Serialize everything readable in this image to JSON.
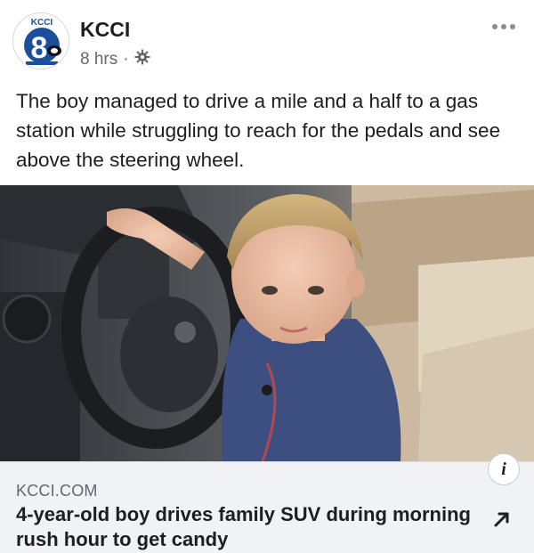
{
  "header": {
    "avatar_text": "8",
    "avatar_top_text": "KCCI",
    "page_name": "KCCI",
    "timestamp": "8 hrs",
    "separator": "·",
    "audience_icon": "gear-icon",
    "more_icon": "more-dots-icon"
  },
  "post": {
    "text": "The boy managed to drive a mile and a half to a gas station while struggling to reach for the pedals and see above the steering wheel."
  },
  "photo": {
    "subject": "boy-at-steering-wheel"
  },
  "link": {
    "domain": "KCCI.COM",
    "title": "4-year-old boy drives family SUV during morning rush hour to get candy",
    "info_label": "i",
    "share_icon": "arrow-up-right-icon"
  },
  "colors": {
    "brand_blue": "#1b4f9c",
    "card_background": "#f0f2f5",
    "meta_gray": "#65676b"
  }
}
